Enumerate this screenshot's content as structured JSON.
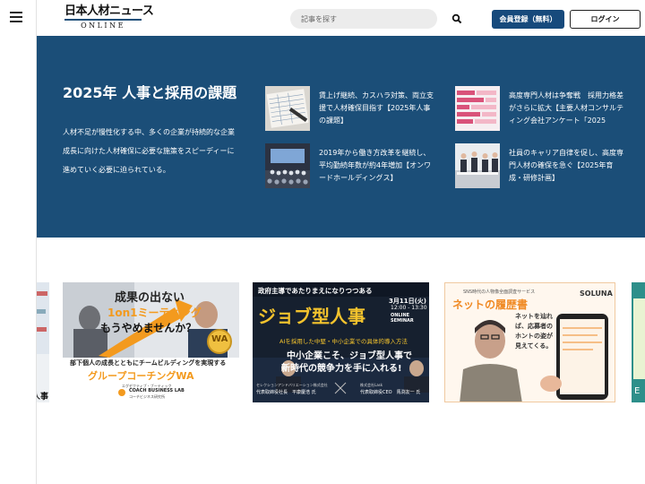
{
  "header": {
    "logo_main": "日本人材ニュース",
    "logo_sub": "ONLINE",
    "search_placeholder": "記事を探す",
    "register_label": "会員登録（無料）",
    "login_label": "ログイン"
  },
  "hero": {
    "title": "2025年 人事と採用の課題",
    "description": "人材不足が慢性化する中、多くの企業が持続的な企業成長に向けた人材確保に必要な施策をスピーディーに進めていく必要に迫られている。",
    "articles": [
      {
        "title": "賃上げ継続、カスハラ対策、両立支援で人材確保目指す【2025年人事の課題】"
      },
      {
        "title": "高度専門人材は争奪戦　採用力格差がさらに拡大【主要人材コンサルティング会社アンケート「2025"
      },
      {
        "title": "2019年から働き方改革を継続し、平均勤続年数が約4年増加【オンワードホールディングス】"
      },
      {
        "title": "社員のキャリア自律を促し、高度専門人材の確保を急ぐ【2025年育成・研修計画】"
      }
    ]
  },
  "banners": [
    {
      "partial_text": "人事"
    },
    {
      "headline": "成果の出ない",
      "highlight": "1on1ミーティング",
      "question": "もうやめませんか？",
      "subline": "部下個人の成長とともにチームビルディングを実現する",
      "product": "グループコーチングWA",
      "badge": "WA",
      "company": "COACH BUSINESS LAB",
      "company_jp": "コーチビジネス研究所",
      "company_top": "エグゼクティブ・ブーティック"
    },
    {
      "tagline": "政府主導であたりまえになりつつある",
      "title": "ジョブ型人事",
      "date": "3月11日(火)",
      "time": "12:00 - 13:30",
      "tag": "ONLINE SEMINAR",
      "subtitle": "AIを採用した中堅・中小企業での具体的導入方法",
      "headline1": "中小企業こそ、ジョブ型人事で",
      "headline2": "新時代の競争力を手に入れる!",
      "speaker1_org": "セレクションアンドバリエーション株式会社",
      "speaker1": "代表取締役社長　平康慶浩 氏",
      "speaker2_org": "株式会社Lask",
      "speaker2": "代表取締役CEO　馬渕友一 氏"
    },
    {
      "tagline": "SNS時代の人物像全面調査サービス",
      "title": "ネットの履歴書",
      "brand": "SOLUNA",
      "copy": "ネットを辿れば、応募者のホントの姿が見えてくる。"
    },
    {
      "partial_text": "E"
    }
  ],
  "colors": {
    "brand_navy": "#1b4e78",
    "button_navy": "#174a7c",
    "banner_orange": "#f39a1e",
    "seminar_bg": "#16202f",
    "seminar_gold": "#f4c32d",
    "soluna_orange": "#f08a24"
  },
  "icons": {
    "menu": "hamburger-icon",
    "search": "search-icon"
  }
}
